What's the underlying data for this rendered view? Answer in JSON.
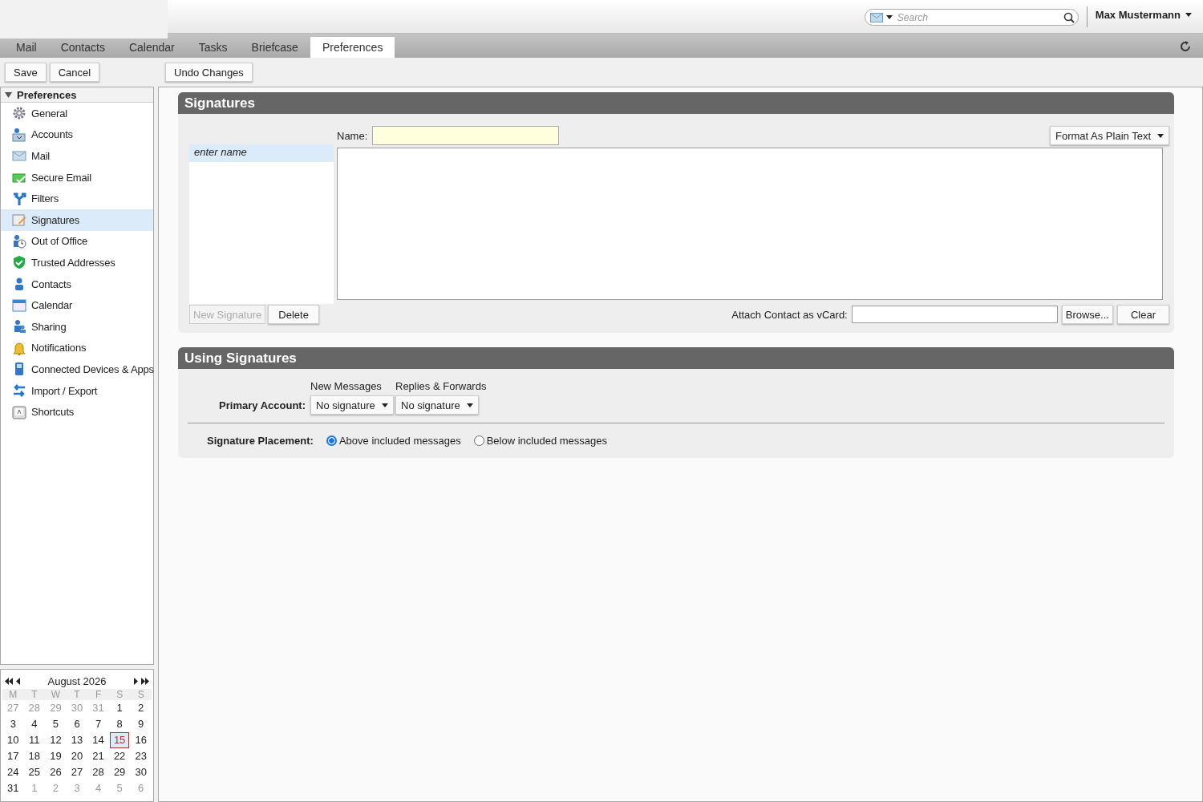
{
  "header": {
    "search": {
      "placeholder": "Search"
    },
    "user": "Max Mustermann"
  },
  "tabs": [
    {
      "label": "Mail",
      "selected": false
    },
    {
      "label": "Contacts",
      "selected": false
    },
    {
      "label": "Calendar",
      "selected": false
    },
    {
      "label": "Tasks",
      "selected": false
    },
    {
      "label": "Briefcase",
      "selected": false
    },
    {
      "label": "Preferences",
      "selected": true
    }
  ],
  "toolbar": {
    "buttons": [
      "Save",
      "Cancel"
    ],
    "undo": "Undo Changes"
  },
  "sidebar": {
    "title": "Preferences",
    "expanded": true,
    "items": [
      {
        "label": "General",
        "selected": false
      },
      {
        "label": "Accounts",
        "selected": false
      },
      {
        "label": "Mail",
        "selected": false
      },
      {
        "label": "Secure Email",
        "selected": false
      },
      {
        "label": "Filters",
        "selected": false
      },
      {
        "label": "Signatures",
        "selected": true
      },
      {
        "label": "Out of Office",
        "selected": false
      },
      {
        "label": "Trusted Addresses",
        "selected": false
      },
      {
        "label": "Contacts",
        "selected": false
      },
      {
        "label": "Calendar",
        "selected": false
      },
      {
        "label": "Sharing",
        "selected": false
      },
      {
        "label": "Notifications",
        "selected": false
      },
      {
        "label": "Connected Devices & Apps",
        "selected": false
      },
      {
        "label": "Import / Export",
        "selected": false
      },
      {
        "label": "Shortcuts",
        "selected": false
      }
    ]
  },
  "calendar": {
    "month": "August 2026",
    "weekdays": [
      "M",
      "T",
      "W",
      "T",
      "F",
      "S",
      "S"
    ],
    "weeks": [
      [
        {
          "day": "27",
          "other_month": true,
          "selected": false
        },
        {
          "day": "28",
          "other_month": true,
          "selected": false
        },
        {
          "day": "29",
          "other_month": true,
          "selected": false
        },
        {
          "day": "30",
          "other_month": true,
          "selected": false
        },
        {
          "day": "31",
          "other_month": true,
          "selected": false
        },
        {
          "day": "1",
          "other_month": false,
          "selected": false
        },
        {
          "day": "2",
          "other_month": false,
          "selected": false
        }
      ],
      [
        {
          "day": "3",
          "other_month": false,
          "selected": false
        },
        {
          "day": "4",
          "other_month": false,
          "selected": false
        },
        {
          "day": "5",
          "other_month": false,
          "selected": false
        },
        {
          "day": "6",
          "other_month": false,
          "selected": false
        },
        {
          "day": "7",
          "other_month": false,
          "selected": false
        },
        {
          "day": "8",
          "other_month": false,
          "selected": false
        },
        {
          "day": "9",
          "other_month": false,
          "selected": false
        }
      ],
      [
        {
          "day": "10",
          "other_month": false,
          "selected": false
        },
        {
          "day": "11",
          "other_month": false,
          "selected": false
        },
        {
          "day": "12",
          "other_month": false,
          "selected": false
        },
        {
          "day": "13",
          "other_month": false,
          "selected": false
        },
        {
          "day": "14",
          "other_month": false,
          "selected": false
        },
        {
          "day": "15",
          "other_month": false,
          "selected": true
        },
        {
          "day": "16",
          "other_month": false,
          "selected": false
        }
      ],
      [
        {
          "day": "17",
          "other_month": false,
          "selected": false
        },
        {
          "day": "18",
          "other_month": false,
          "selected": false
        },
        {
          "day": "19",
          "other_month": false,
          "selected": false
        },
        {
          "day": "20",
          "other_month": false,
          "selected": false
        },
        {
          "day": "21",
          "other_month": false,
          "selected": false
        },
        {
          "day": "22",
          "other_month": false,
          "selected": false
        },
        {
          "day": "23",
          "other_month": false,
          "selected": false
        }
      ],
      [
        {
          "day": "24",
          "other_month": false,
          "selected": false
        },
        {
          "day": "25",
          "other_month": false,
          "selected": false
        },
        {
          "day": "26",
          "other_month": false,
          "selected": false
        },
        {
          "day": "27",
          "other_month": false,
          "selected": false
        },
        {
          "day": "28",
          "other_month": false,
          "selected": false
        },
        {
          "day": "29",
          "other_month": false,
          "selected": false
        },
        {
          "day": "30",
          "other_month": false,
          "selected": false
        }
      ],
      [
        {
          "day": "31",
          "other_month": false,
          "selected": false
        },
        {
          "day": "1",
          "other_month": true,
          "selected": false
        },
        {
          "day": "2",
          "other_month": true,
          "selected": false
        },
        {
          "day": "3",
          "other_month": true,
          "selected": false
        },
        {
          "day": "4",
          "other_month": true,
          "selected": false
        },
        {
          "day": "5",
          "other_month": true,
          "selected": false
        },
        {
          "day": "6",
          "other_month": true,
          "selected": false
        }
      ]
    ]
  },
  "signatures": {
    "title": "Signatures",
    "name_label": "Name:",
    "format_button": "Format As Plain Text",
    "list": [
      {
        "label": "enter name",
        "selected": true
      }
    ],
    "new_button": {
      "label": "New Signature",
      "disabled": true
    },
    "delete_button": {
      "label": "Delete",
      "disabled": false
    },
    "vcard_label": "Attach Contact as vCard:",
    "browse_button": "Browse...",
    "clear_button": "Clear"
  },
  "using": {
    "title": "Using Signatures",
    "columns": [
      "New Messages",
      "Replies & Forwards"
    ],
    "row": {
      "label": "Primary Account:",
      "selects": [
        "No signature",
        "No signature"
      ]
    },
    "placement": {
      "label": "Signature Placement:",
      "options": [
        {
          "label": "Above included messages",
          "selected": true
        },
        {
          "label": "Below included messages",
          "selected": false
        }
      ]
    }
  }
}
